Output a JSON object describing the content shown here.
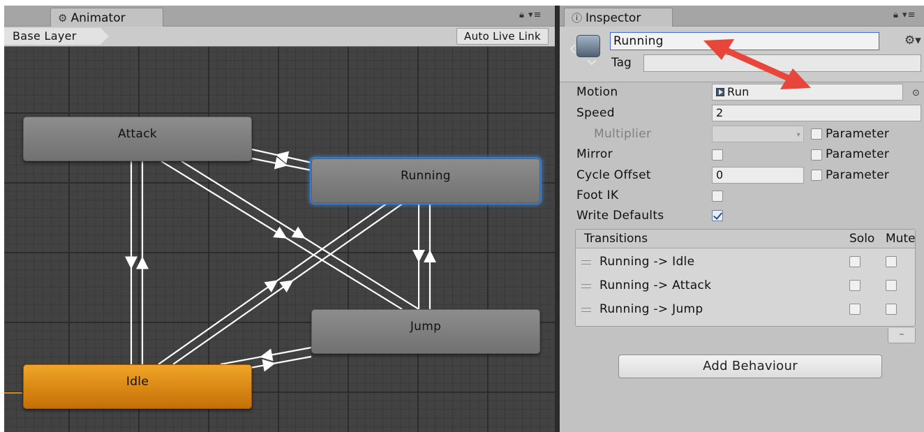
{
  "animator": {
    "tab_label": "Animator",
    "tab_icon": "animator-icon",
    "breadcrumb": "Base Layer",
    "auto_live_link": "Auto Live Link",
    "states": {
      "attack": "Attack",
      "running": "Running",
      "jump": "Jump",
      "idle": "Idle"
    },
    "colors": {
      "default_state": "#7f7f7f",
      "entry_state": "#e08a12",
      "selected_outline": "#3a79c4",
      "transition": "#ffffff"
    }
  },
  "inspector": {
    "tab_label": "Inspector",
    "tab_icon": "info-icon",
    "state_name": "Running",
    "tag_label": "Tag",
    "tag_value": "",
    "properties": {
      "motion_label": "Motion",
      "motion_value": "Run",
      "speed_label": "Speed",
      "speed_value": "2",
      "multiplier_label": "Multiplier",
      "multiplier_value": "",
      "mirror_label": "Mirror",
      "cycle_offset_label": "Cycle Offset",
      "cycle_offset_value": "0",
      "foot_ik_label": "Foot IK",
      "write_defaults_label": "Write Defaults",
      "parameter_label": "Parameter"
    },
    "checks": {
      "mirror": false,
      "foot_ik": false,
      "write_defaults": true,
      "multiplier_param": false,
      "mirror_param": false,
      "cycle_param": false
    },
    "transitions": {
      "title": "Transitions",
      "solo_label": "Solo",
      "mute_label": "Mute",
      "items": [
        {
          "label": "Running -> Idle",
          "solo": false,
          "mute": false
        },
        {
          "label": "Running -> Attack",
          "solo": false,
          "mute": false
        },
        {
          "label": "Running -> Jump",
          "solo": false,
          "mute": false
        }
      ],
      "remove_label": "–"
    },
    "add_behaviour": "Add Behaviour",
    "annotation_color": "#e8463a"
  }
}
